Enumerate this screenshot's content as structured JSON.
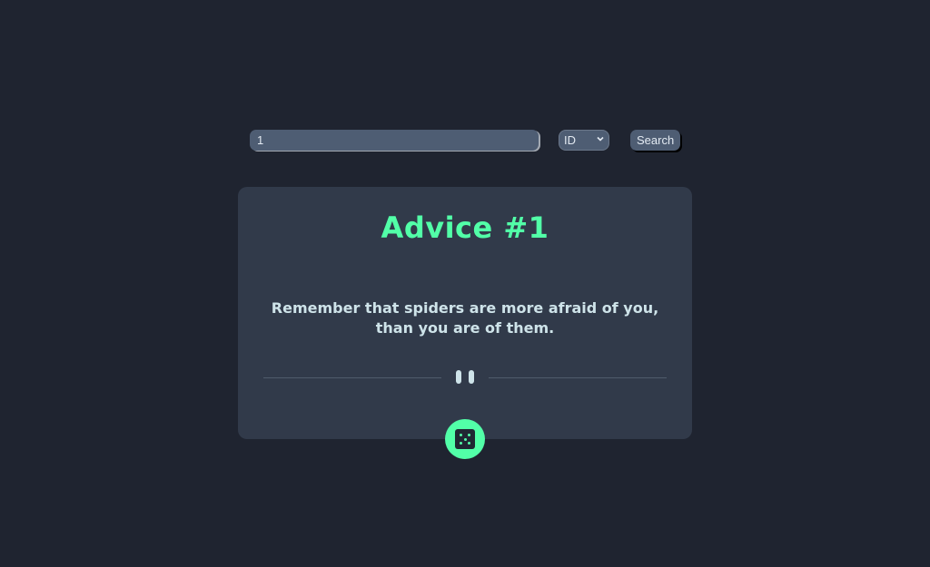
{
  "search": {
    "value": "1",
    "select_value": "ID",
    "button_label": "Search"
  },
  "card": {
    "title": "Advice #1",
    "advice": "Remember that spiders are more afraid of you, than you are of them."
  },
  "colors": {
    "background": "#1f2430",
    "card": "#313a4a",
    "accent": "#52ffa8",
    "text": "#cee3e9",
    "input": "#4e5d73"
  },
  "icons": {
    "divider": "pause-icon",
    "action": "dice-icon",
    "select": "chevron-down-icon"
  }
}
